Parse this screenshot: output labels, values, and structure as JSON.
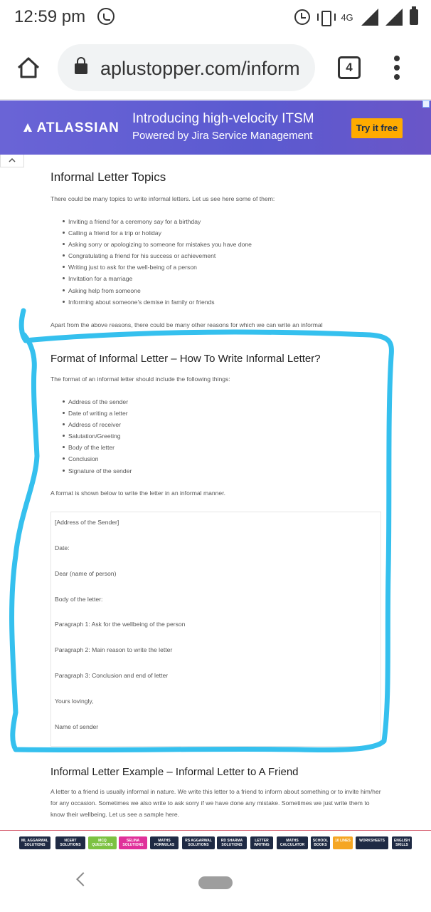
{
  "status_bar": {
    "time": "12:59 pm",
    "network": "4G"
  },
  "browser": {
    "url": "aplustopper.com/inform",
    "tab_count": "4"
  },
  "ad": {
    "brand": "ATLASSIAN",
    "headline": "Introducing high-velocity ITSM",
    "subheadline": "Powered by Jira Service Management",
    "cta": "Try it free"
  },
  "article": {
    "section1": {
      "heading": "Informal Letter Topics",
      "intro": "There could be many topics to write informal letters. Let us see here some of them:",
      "items": [
        "Inviting a friend for a ceremony say for a birthday",
        "Calling a friend for a trip or holiday",
        "Asking sorry or apologizing to someone for mistakes you have done",
        "Congratulating a friend for his success or achievement",
        "Writing just to ask for the well-being of a person",
        "Invitation for a marriage",
        "Asking help from someone",
        "Informing about someone's demise in family or friends"
      ],
      "outro": "Apart from the above reasons, there could be many other reasons for which we can write an informal"
    },
    "section2": {
      "heading": "Format of Informal Letter – How To Write Informal Letter?",
      "intro": "The format of an informal letter should include the following things:",
      "items": [
        "Address of the sender",
        "Date of writing a letter",
        "Address of receiver",
        "Salutation/Greeting",
        "Body of the letter",
        "Conclusion",
        "Signature of the sender"
      ],
      "outro": "A format is shown below to write the letter in an informal manner.",
      "letter_lines": [
        "[Address of the Sender]",
        "Date:",
        "Dear (name of person)",
        "Body of the letter:",
        "Paragraph 1: Ask for the wellbeing of the person",
        "Paragraph 2: Main reason to write the letter",
        "Paragraph 3: Conclusion and end of letter",
        "Yours lovingly,",
        "Name of sender"
      ]
    },
    "section3": {
      "heading": "Informal Letter Example – Informal Letter to A Friend",
      "body": "A letter to a friend is usually informal in nature. We write this letter to a friend to inform about something or to invite him/her for any occasion. Sometimes we also write to ask sorry if we have done any mistake. Sometimes we just write them to know their wellbeing. Let us see a sample here."
    }
  },
  "footer_links": [
    {
      "label": "ML AGGARWAL SOLUTIONS",
      "color": "#1f2a44"
    },
    {
      "label": "NCERT SOLUTIONS",
      "color": "#1f2a44"
    },
    {
      "label": "MCQ QUESTIONS",
      "color": "#7cc242"
    },
    {
      "label": "SELINA SOLUTIONS",
      "color": "#e0309a"
    },
    {
      "label": "MATHS FORMULAS",
      "color": "#1f2a44"
    },
    {
      "label": "RS AGGARWAL SOLUTIONS",
      "color": "#1f2a44"
    },
    {
      "label": "RD SHARMA SOLUTIONS",
      "color": "#1f2a44"
    },
    {
      "label": "LETTER WRITING",
      "color": "#1f2a44"
    },
    {
      "label": "MATHS CALCULATOR",
      "color": "#1f2a44"
    },
    {
      "label": "SCHOOL BOOKS",
      "color": "#1f2a44"
    },
    {
      "label": "10 LINES",
      "color": "#f5a623"
    },
    {
      "label": "WORKSHEETS",
      "color": "#1f2a44"
    },
    {
      "label": "ENGLISH SKILLS",
      "color": "#1f2a44"
    }
  ],
  "colors": {
    "ad_bg": "#5b5ad0",
    "ad_cta": "#ffab00",
    "scribble": "#35c0ee"
  }
}
